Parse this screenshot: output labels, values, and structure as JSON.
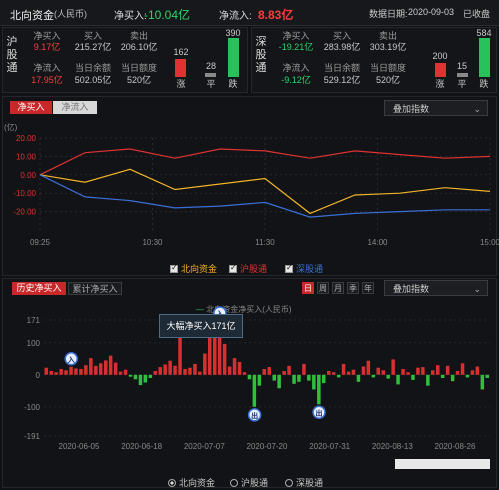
{
  "header": {
    "title": "北向资金",
    "currency": "(人民币)",
    "net_buy_label": "净买入:",
    "net_buy_value": "-10.04亿",
    "net_inflow_label": "净流入:",
    "net_inflow_value": "8.83亿",
    "date_label": "数据日期:",
    "date_value": "2020-09-03",
    "status": "已收盘"
  },
  "sh_panel": {
    "name": "沪股通",
    "net_buy_label": "净买入",
    "net_buy_value": "9.17亿",
    "buy_label": "买入",
    "buy_value": "215.27亿",
    "sell_label": "卖出",
    "sell_value": "206.10亿",
    "net_inflow_label": "净流入",
    "net_inflow_value": "17.95亿",
    "balance_label": "当日余额",
    "balance_value": "502.05亿",
    "quota_label": "当日额度",
    "quota_value": "520亿",
    "up_count": "162",
    "flat_count": "28",
    "down_count": "390",
    "up_label": "涨",
    "flat_label": "平",
    "down_label": "跌"
  },
  "sz_panel": {
    "name": "深股通",
    "net_buy_label": "净买入",
    "net_buy_value": "-19.21亿",
    "buy_label": "买入",
    "buy_value": "283.98亿",
    "sell_label": "卖出",
    "sell_value": "303.19亿",
    "net_inflow_label": "净流入",
    "net_inflow_value": "-9.12亿",
    "balance_label": "当日余额",
    "balance_value": "529.12亿",
    "quota_label": "当日额度",
    "quota_value": "520亿",
    "up_count": "200",
    "flat_count": "15",
    "down_count": "584",
    "up_label": "涨",
    "flat_label": "平",
    "down_label": "跌"
  },
  "intraday": {
    "tabs": [
      "净买入",
      "净流入"
    ],
    "overlay_label": "叠加指数",
    "unit": "(亿)",
    "legend": [
      "北向资金",
      "沪股通",
      "深股通"
    ],
    "colors": {
      "north": "#f0b429",
      "sh": "#e03232",
      "sz": "#3b6fd8"
    }
  },
  "history": {
    "tabs": [
      "历史净买入",
      "累计净买入"
    ],
    "period_buttons": [
      "日",
      "周",
      "月",
      "季",
      "年"
    ],
    "overlay_label": "叠加指数",
    "legend_label": "北向资金净买入(人民币)",
    "tooltip": "大幅净买入171亿",
    "marker_in": "入",
    "marker_out": "出",
    "radios": [
      "北向资金",
      "沪股通",
      "深股通"
    ]
  },
  "chart_data": [
    {
      "type": "line",
      "x": [
        "09:25",
        "10:30",
        "11:30",
        "14:00",
        "15:00"
      ],
      "ylabel": "(亿)",
      "ylim": [
        -30,
        20
      ],
      "yticks": [
        "20.00",
        "10.00",
        "0.00",
        "-10.00",
        "-20.00"
      ],
      "series": [
        {
          "name": "沪股通",
          "values": [
            0,
            12,
            14,
            9,
            14,
            13,
            9,
            13,
            11,
            9,
            10
          ]
        },
        {
          "name": "北向资金",
          "values": [
            0,
            -4,
            3,
            -8,
            -5,
            -2,
            -21,
            -11,
            -10,
            -7,
            -9
          ]
        },
        {
          "name": "深股通",
          "values": [
            0,
            -12,
            -14,
            -18,
            -17,
            -15,
            -23,
            -21,
            -20,
            -19,
            -19
          ]
        }
      ]
    },
    {
      "type": "bar",
      "categories": [
        "2020-06-05",
        "2020-06-18",
        "2020-07-07",
        "2020-07-20",
        "2020-07-31",
        "2020-08-13",
        "2020-08-26"
      ],
      "yticks": [
        "171",
        "100",
        "0",
        "-100",
        "-191"
      ],
      "ylim": [
        -191,
        171
      ],
      "values": [
        22,
        12,
        8,
        18,
        14,
        25,
        20,
        18,
        30,
        52,
        28,
        36,
        45,
        60,
        38,
        10,
        16,
        -6,
        -14,
        -32,
        -24,
        -10,
        12,
        24,
        32,
        44,
        28,
        171,
        18,
        22,
        34,
        10,
        66,
        140,
        120,
        168,
        96,
        26,
        52,
        40,
        8,
        -14,
        -100,
        -34,
        18,
        24,
        -18,
        -42,
        12,
        28,
        -28,
        -22,
        34,
        -18,
        -46,
        -92,
        -26,
        12,
        8,
        -8,
        34,
        10,
        16,
        -22,
        26,
        44,
        -8,
        22,
        14,
        -12,
        48,
        -30,
        18,
        8,
        -16,
        22,
        24,
        -34,
        14,
        30,
        -10,
        28,
        -20,
        12,
        36,
        -8,
        14,
        26,
        -46,
        -10
      ]
    }
  ]
}
